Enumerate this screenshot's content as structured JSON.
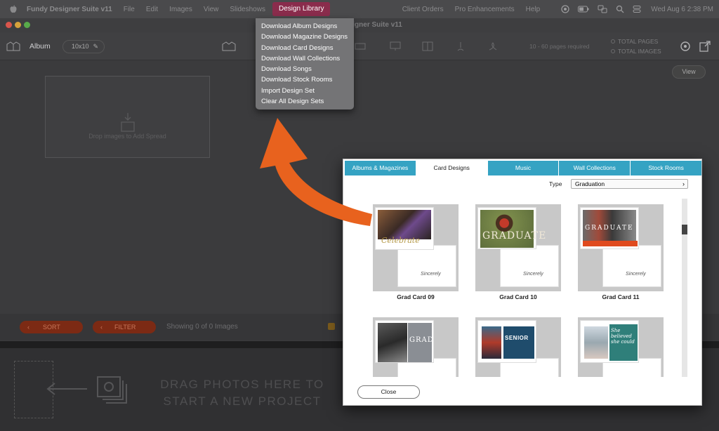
{
  "menubar": {
    "app_name": "Fundy Designer Suite v11",
    "menus": [
      "File",
      "Edit",
      "Images",
      "View",
      "Slideshows"
    ],
    "open_menu": "Design Library",
    "right_menus": [
      "Client Orders",
      "Pro Enhancements",
      "Help"
    ],
    "clock": "Wed Aug 6  2:38 PM"
  },
  "window": {
    "title": "Fundy Designer Suite v11"
  },
  "toolbar": {
    "album_label": "Album",
    "size_label": "10x10",
    "pages_required": "10 - 60 pages required",
    "total_pages": "TOTAL PAGES",
    "total_images": "TOTAL IMAGES"
  },
  "workarea": {
    "drop_text": "Drop images to Add Spread",
    "view_button": "View"
  },
  "filterbar": {
    "sort_label": "SORT",
    "filter_label": "FILTER",
    "showing": "Showing 0 of 0 Images"
  },
  "dragarea": {
    "text_line1": "DRAG PHOTOS HERE TO",
    "text_line2": "START A NEW PROJECT"
  },
  "design_menu": {
    "items": [
      "Download Album Designs",
      "Download Magazine Designs",
      "Download Card Designs",
      "Download Wall Collections",
      "Download Songs",
      "Download Stock Rooms",
      "Import Design Set",
      "Clear All Design Sets"
    ]
  },
  "dialog": {
    "tabs": [
      "Albums & Magazines",
      "Card Designs",
      "Music",
      "Wall Collections",
      "Stock Rooms"
    ],
    "active_tab": "Card Designs",
    "type_label": "Type",
    "type_value": "Graduation",
    "cards": [
      {
        "name": "Grad Card 09",
        "overlay": "Celebrate"
      },
      {
        "name": "Grad Card 10",
        "overlay": "GRADUATE"
      },
      {
        "name": "Grad Card 11",
        "overlay": "GRADUATE"
      },
      {
        "name": "",
        "overlay": "GRAD"
      },
      {
        "name": "",
        "overlay": "SENIOR"
      },
      {
        "name": "",
        "overlay": "She believed she could"
      }
    ],
    "close_label": "Close"
  },
  "colors": {
    "menu_highlight": "#8a2c4c",
    "tab_blue": "#35a3c3",
    "arrow_orange": "#e8621e",
    "sort_button": "#7c2a14"
  }
}
